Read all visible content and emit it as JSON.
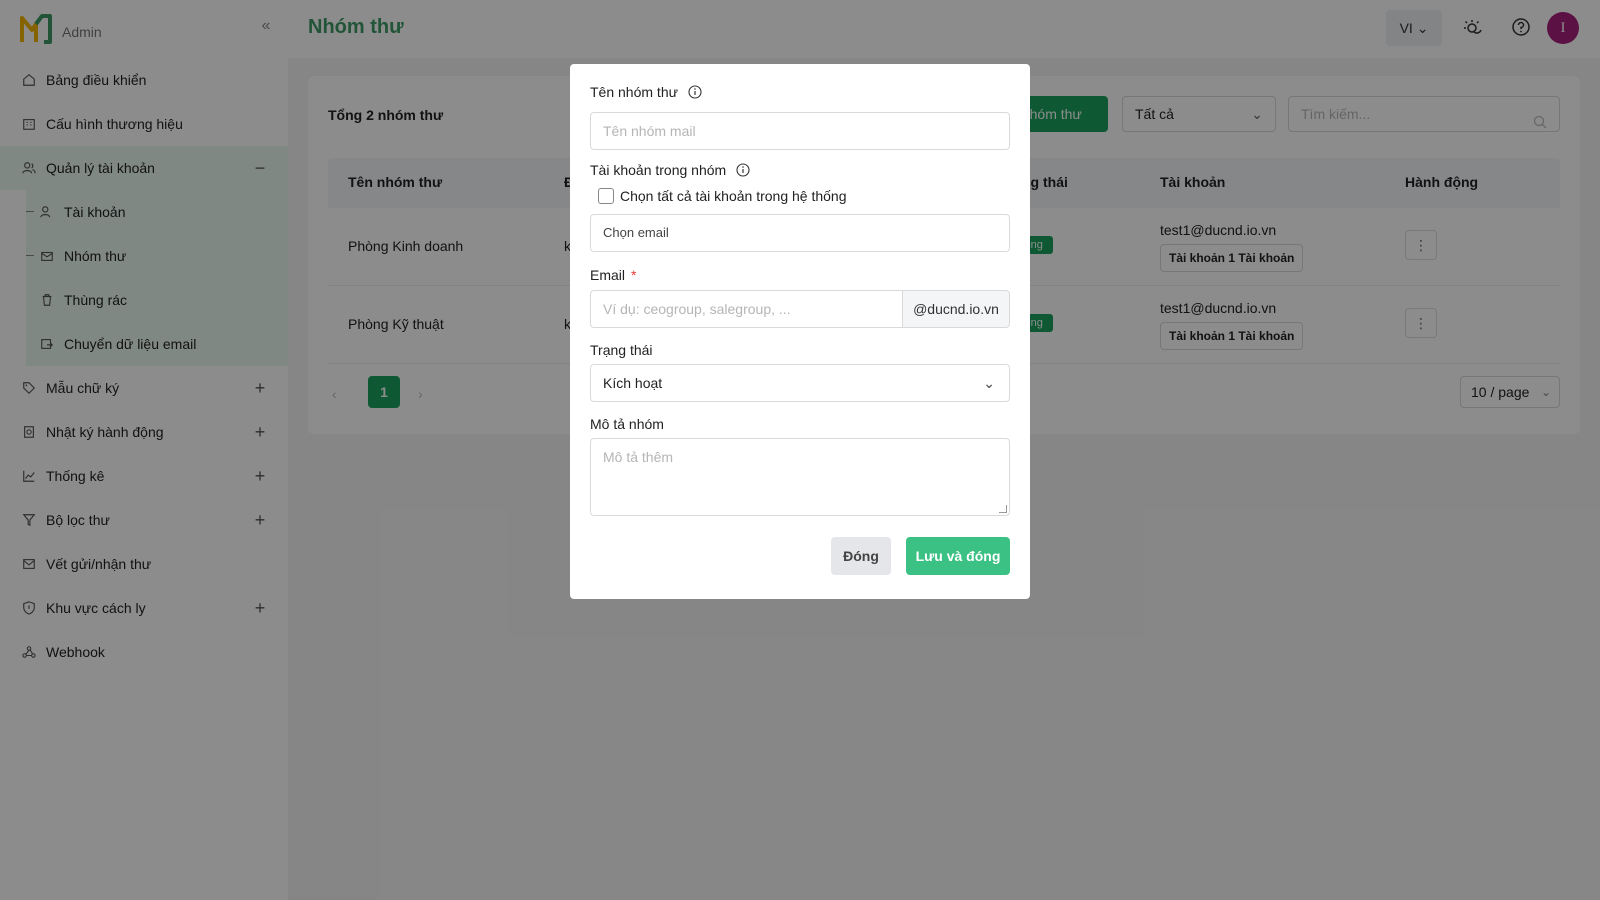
{
  "app": {
    "logo_text": "Admin"
  },
  "header": {
    "title": "Nhóm thư",
    "lang": "VI",
    "avatar_letter": "I"
  },
  "sidebar": {
    "items": [
      {
        "label": "Bảng điều khiển",
        "icon": "home-icon"
      },
      {
        "label": "Cấu hình thương hiệu",
        "icon": "building-icon"
      },
      {
        "label": "Quản lý tài khoản",
        "icon": "users-icon",
        "toggle": "−"
      },
      {
        "label": "Mẫu chữ ký",
        "icon": "tag-icon",
        "toggle": "+"
      },
      {
        "label": "Nhật ký hành động",
        "icon": "log-icon",
        "toggle": "+"
      },
      {
        "label": "Thống kê",
        "icon": "chart-icon",
        "toggle": "+"
      },
      {
        "label": "Bộ lọc thư",
        "icon": "filter-icon",
        "toggle": "+"
      },
      {
        "label": "Vết gửi/nhận thư",
        "icon": "mail-icon"
      },
      {
        "label": "Khu vực cách ly",
        "icon": "shield-icon",
        "toggle": "+"
      },
      {
        "label": "Webhook",
        "icon": "webhook-icon"
      }
    ],
    "sub_items": [
      {
        "label": "Tài khoản",
        "icon": "user-icon"
      },
      {
        "label": "Nhóm thư",
        "icon": "mail-group-icon"
      },
      {
        "label": "Thùng rác",
        "icon": "trash-icon"
      },
      {
        "label": "Chuyển dữ liệu email",
        "icon": "transfer-icon"
      }
    ]
  },
  "main": {
    "total": "Tổng 2 nhóm thư",
    "create_button": "o nhóm thư",
    "filter_value": "Tất cả",
    "search_placeholder": "Tìm kiếm...",
    "columns": [
      "Tên nhóm thư",
      "Đ",
      "ng thái",
      "Tài khoản",
      "Hành động"
    ],
    "rows": [
      {
        "name": "Phòng Kinh doanh",
        "col2": "k",
        "status": "oạt động",
        "account": "test1@ducnd.io.vn",
        "tag": "Tài khoản 1 Tài khoản"
      },
      {
        "name": "Phòng Kỹ thuật",
        "col2": "k",
        "status": "oạt động",
        "account": "test1@ducnd.io.vn",
        "tag": "Tài khoản 1 Tài khoản"
      }
    ],
    "pagination": {
      "current": "1",
      "page_size": "10 / page"
    }
  },
  "modal": {
    "group_name_label": "Tên nhóm thư",
    "group_name_placeholder": "Tên nhóm mail",
    "accounts_label": "Tài khoản trong nhóm",
    "select_all_label": "Chọn tất cả tài khoản trong hệ thống",
    "select_email_placeholder": "Chọn email",
    "email_label": "Email",
    "email_required_mark": "*",
    "email_placeholder": "Ví dụ: ceogroup, salegroup, ...",
    "email_suffix": "@ducnd.io.vn",
    "status_label": "Trạng thái",
    "status_value": "Kích hoạt",
    "description_label": "Mô tả nhóm",
    "description_placeholder": "Mô tả thêm",
    "close_button": "Đóng",
    "save_button": "Lưu và đóng"
  },
  "colors": {
    "brand_green": "#1aa260",
    "title_green": "#3e9b67",
    "save_green": "#3cc184",
    "avatar": "#a6207b"
  }
}
